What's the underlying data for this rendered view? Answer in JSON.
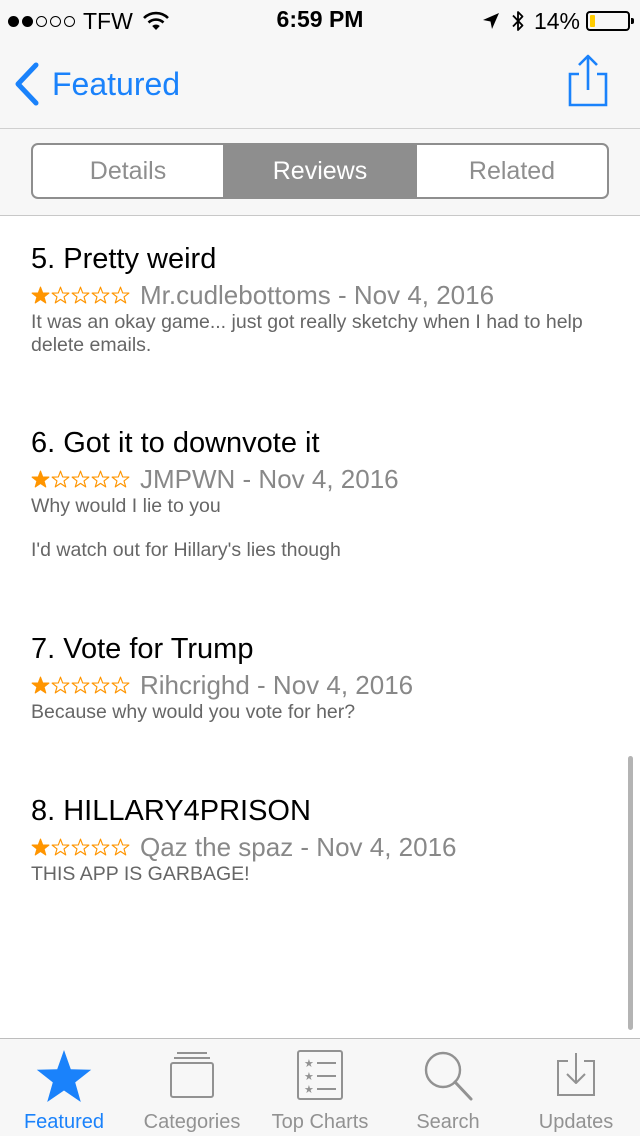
{
  "status_bar": {
    "carrier": "TFW",
    "time": "6:59 PM",
    "battery_percent": "14%",
    "battery_level": 0.14,
    "signal_bars_filled": 2,
    "signal_bars_total": 5
  },
  "nav": {
    "back_label": "Featured",
    "share_icon": "share-icon"
  },
  "segments": {
    "items": [
      "Details",
      "Reviews",
      "Related"
    ],
    "selected": "Reviews"
  },
  "reviews": [
    {
      "title": "5. Pretty weird",
      "rating": 1,
      "author_date": "Mr.cudlebottoms - Nov 4, 2016",
      "body": [
        "It was an okay game... just got really sketchy when I had to help delete emails."
      ]
    },
    {
      "title": "6. Got it to downvote it",
      "rating": 1,
      "author_date": "JMPWN - Nov 4, 2016",
      "body": [
        "Why would I lie to you",
        "I'd watch out for Hillary's lies though"
      ]
    },
    {
      "title": "7. Vote for Trump",
      "rating": 1,
      "author_date": "Rihcrighd - Nov 4, 2016",
      "body": [
        "Because why would you vote for her?"
      ]
    },
    {
      "title": "8. HILLARY4PRISON",
      "rating": 1,
      "author_date": "Qaz the spaz - Nov 4, 2016",
      "body": [
        "THIS APP IS GARBAGE!"
      ]
    }
  ],
  "tab_bar": {
    "items": [
      {
        "label": "Featured",
        "icon": "star-icon",
        "active": true
      },
      {
        "label": "Categories",
        "icon": "categories-icon",
        "active": false
      },
      {
        "label": "Top Charts",
        "icon": "top-charts-icon",
        "active": false
      },
      {
        "label": "Search",
        "icon": "search-icon",
        "active": false
      },
      {
        "label": "Updates",
        "icon": "updates-icon",
        "active": false
      }
    ]
  },
  "colors": {
    "accent": "#1a82fb",
    "star": "#ff9500",
    "segment": "#8e8e8e",
    "battery_fill": "#ffcc00"
  }
}
